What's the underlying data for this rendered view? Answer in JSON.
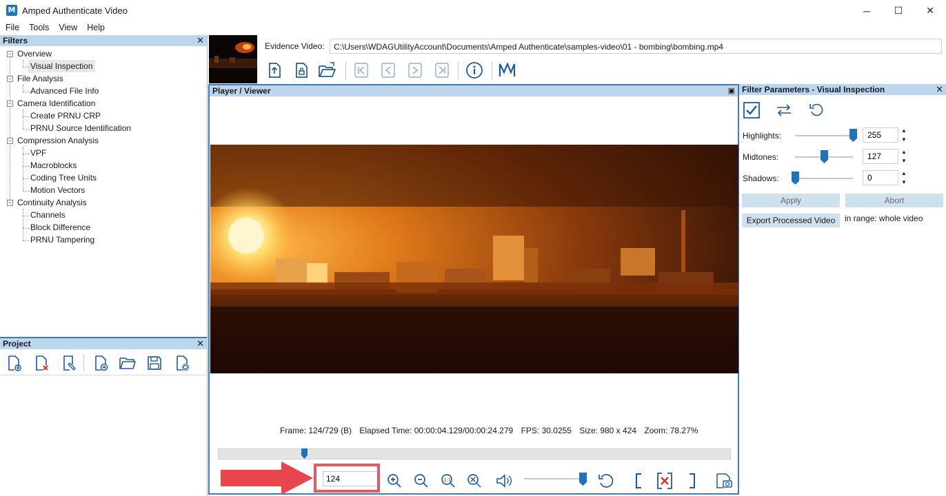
{
  "window": {
    "title": "Amped Authenticate Video",
    "app_icon": "amped-logo-icon",
    "minimize_icon": "─",
    "maximize_icon": "☐",
    "close_icon": "✕"
  },
  "menu": {
    "items": [
      "File",
      "Tools",
      "View",
      "Help"
    ]
  },
  "filters_panel": {
    "title": "Filters",
    "close": "✕",
    "tree": [
      {
        "label": "Overview",
        "level": 0,
        "expanded": true
      },
      {
        "label": "Visual Inspection",
        "level": 1,
        "selected": true
      },
      {
        "label": "File Analysis",
        "level": 0,
        "expanded": true
      },
      {
        "label": "Advanced File Info",
        "level": 1
      },
      {
        "label": "Camera Identification",
        "level": 0,
        "expanded": true
      },
      {
        "label": "Create PRNU CRP",
        "level": 1
      },
      {
        "label": "PRNU Source Identification",
        "level": 1
      },
      {
        "label": "Compression Analysis",
        "level": 0,
        "expanded": true
      },
      {
        "label": "VPF",
        "level": 1
      },
      {
        "label": "Macroblocks",
        "level": 1
      },
      {
        "label": "Coding Tree Units",
        "level": 1
      },
      {
        "label": "Motion Vectors",
        "level": 1
      },
      {
        "label": "Continuity Analysis",
        "level": 0,
        "expanded": true
      },
      {
        "label": "Channels",
        "level": 1
      },
      {
        "label": "Block Difference",
        "level": 1
      },
      {
        "label": "PRNU Tampering",
        "level": 1
      }
    ]
  },
  "project_panel": {
    "title": "Project",
    "close": "✕",
    "toolbar": [
      "new-project-icon",
      "remove-item-icon",
      "bookmark-icon",
      "add-file-icon",
      "open-folder-icon",
      "save-icon",
      "project-settings-icon"
    ]
  },
  "evidence": {
    "label": "Evidence Video:",
    "path": "C:\\Users\\WDAGUtilityAccount\\Documents\\Amped Authenticate\\samples-video\\01 - bombing\\bombing.mp4",
    "toolbar": [
      "load-video-icon",
      "load-reference-icon",
      "open-recent-icon",
      "first-frame-icon",
      "previous-frame-icon",
      "next-frame-icon",
      "last-frame-icon",
      "info-icon",
      "amped-logo-icon"
    ]
  },
  "player": {
    "title": "Player / Viewer",
    "status": {
      "frame": "Frame: 124/729 (B)",
      "elapsed": "Elapsed Time: 00:00:04.129/00:00:24.279",
      "fps": "FPS: 30.0255",
      "size": "Size: 980 x 424",
      "zoom": "Zoom: 78.27%"
    },
    "timeline_position": 0.17,
    "frame_value": "124",
    "volume_level": 1.0,
    "controls": [
      "zoom-in-icon",
      "zoom-out-icon",
      "zoom-1to1-icon",
      "zoom-fit-icon",
      "volume-icon",
      "reset-icon",
      "mark-in-icon",
      "clear-range-icon",
      "mark-out-icon",
      "snapshot-icon"
    ]
  },
  "filter_params": {
    "title": "Filter Parameters - Visual Inspection",
    "close": "✕",
    "toolbar": [
      "apply-check-icon",
      "swap-icon",
      "reset-icon"
    ],
    "highlights": {
      "label": "Highlights:",
      "value": "255",
      "level": 1.0
    },
    "midtones": {
      "label": "Midtones:",
      "value": "127",
      "level": 0.5
    },
    "shadows": {
      "label": "Shadows:",
      "value": "0",
      "level": 0.0
    },
    "apply_label": "Apply",
    "abort_label": "Abort",
    "export_label": "Export Processed Video",
    "range_label": "in range: whole video"
  },
  "colors": {
    "panel_header": "#bcd6ee",
    "accent_blue": "#1e73be",
    "active_border": "#3d7ab8",
    "highlight_red": "#e9585e"
  }
}
